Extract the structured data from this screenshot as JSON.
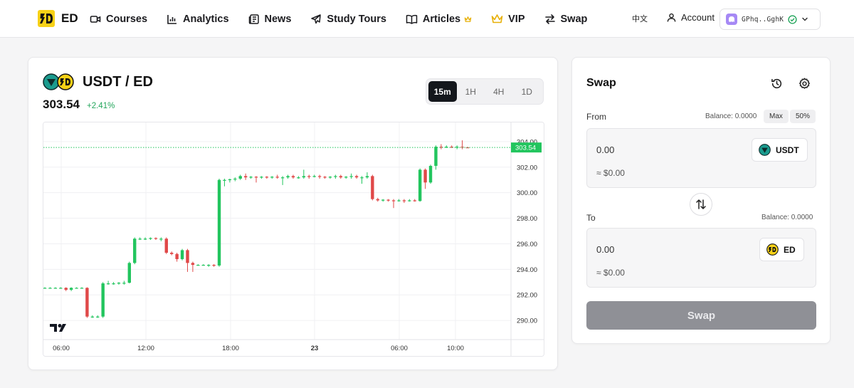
{
  "brand": {
    "name": "ED"
  },
  "nav": [
    {
      "label": "Courses",
      "icon": "video-camera-icon"
    },
    {
      "label": "Analytics",
      "icon": "bar-chart-icon"
    },
    {
      "label": "News",
      "icon": "newspaper-icon"
    },
    {
      "label": "Study Tours",
      "icon": "airplane-icon"
    },
    {
      "label": "Articles",
      "icon": "book-open-icon",
      "badge_icon": "crown-icon"
    },
    {
      "label": "VIP",
      "icon": "crown-icon"
    },
    {
      "label": "Swap",
      "icon": "swap-arrows-icon"
    }
  ],
  "header": {
    "language": "中文",
    "account_label": "Account",
    "wallet_address": "GPhq..GghK"
  },
  "pair": {
    "title": "USDT / ED",
    "price": "303.54",
    "change": "+2.41%",
    "intervals": [
      "15m",
      "1H",
      "4H",
      "1D"
    ],
    "active_interval": "15m"
  },
  "colors": {
    "up": "#22c55e",
    "down": "#e04848",
    "accent_dark": "#14171c",
    "logo_yellow": "#f7d117",
    "usdt_teal": "#1a9b8e"
  },
  "chart_data": {
    "type": "candlestick",
    "x_ticks": [
      "06:00",
      "12:00",
      "18:00",
      "23",
      "06:00",
      "10:00"
    ],
    "y_ticks": [
      "304.00",
      "302.00",
      "300.00",
      "298.00",
      "296.00",
      "294.00",
      "292.00",
      "290.00"
    ],
    "ylim": [
      288.5,
      305.5
    ],
    "last_price_label": "303.54",
    "last_price": 303.54,
    "grid": true,
    "candles": [
      [
        292.55,
        292.55,
        292.6,
        292.5
      ],
      [
        292.55,
        292.55,
        292.6,
        292.5
      ],
      [
        292.55,
        292.55,
        292.6,
        292.5
      ],
      [
        292.55,
        292.55,
        292.6,
        292.5
      ],
      [
        292.55,
        292.4,
        292.6,
        292.3
      ],
      [
        292.4,
        292.55,
        292.6,
        292.3
      ],
      [
        292.55,
        292.55,
        292.6,
        292.5
      ],
      [
        292.55,
        292.55,
        292.6,
        292.5
      ],
      [
        292.55,
        290.3,
        292.6,
        290.2
      ],
      [
        290.3,
        290.3,
        290.4,
        290.2
      ],
      [
        290.3,
        290.3,
        290.4,
        290.2
      ],
      [
        290.3,
        292.9,
        293.0,
        290.2
      ],
      [
        292.9,
        292.9,
        293.1,
        292.8
      ],
      [
        292.9,
        292.9,
        293.0,
        292.8
      ],
      [
        292.9,
        292.95,
        293.0,
        292.8
      ],
      [
        292.95,
        292.95,
        293.1,
        292.8
      ],
      [
        292.95,
        294.5,
        294.6,
        292.9
      ],
      [
        294.5,
        296.4,
        296.5,
        294.4
      ],
      [
        296.4,
        296.4,
        296.5,
        296.3
      ],
      [
        296.4,
        296.4,
        296.5,
        296.3
      ],
      [
        296.4,
        296.45,
        296.5,
        296.3
      ],
      [
        296.45,
        296.4,
        296.5,
        296.3
      ],
      [
        296.4,
        296.4,
        296.5,
        296.2
      ],
      [
        296.4,
        295.3,
        296.5,
        295.2
      ],
      [
        295.3,
        295.2,
        295.4,
        295.1
      ],
      [
        295.2,
        294.8,
        295.3,
        294.6
      ],
      [
        294.8,
        295.5,
        295.6,
        294.7
      ],
      [
        295.5,
        294.5,
        295.6,
        293.8
      ],
      [
        294.5,
        294.35,
        294.6,
        293.8
      ],
      [
        294.35,
        294.35,
        294.4,
        294.3
      ],
      [
        294.35,
        294.35,
        294.4,
        294.3
      ],
      [
        294.35,
        294.35,
        294.4,
        294.2
      ],
      [
        294.35,
        294.3,
        294.4,
        294.2
      ],
      [
        294.3,
        301.0,
        301.1,
        294.2
      ],
      [
        301.0,
        301.0,
        301.1,
        300.5
      ],
      [
        301.0,
        301.05,
        301.1,
        300.8
      ],
      [
        301.05,
        301.1,
        301.2,
        300.9
      ],
      [
        301.1,
        301.3,
        301.4,
        301.0
      ],
      [
        301.3,
        301.2,
        301.5,
        301.0
      ],
      [
        301.2,
        301.25,
        301.3,
        301.1
      ],
      [
        301.25,
        301.2,
        301.3,
        300.8
      ],
      [
        301.2,
        301.25,
        301.3,
        301.1
      ],
      [
        301.25,
        301.2,
        301.3,
        301.1
      ],
      [
        301.2,
        301.25,
        301.3,
        301.1
      ],
      [
        301.25,
        301.2,
        301.4,
        301.1
      ],
      [
        301.2,
        301.2,
        301.3,
        300.6
      ],
      [
        301.2,
        301.3,
        301.4,
        301.1
      ],
      [
        301.3,
        301.2,
        301.4,
        301.1
      ],
      [
        301.2,
        301.2,
        301.3,
        301.1
      ],
      [
        301.2,
        301.3,
        301.8,
        301.1
      ],
      [
        301.3,
        301.25,
        301.4,
        301.1
      ],
      [
        301.25,
        301.3,
        301.4,
        301.2
      ],
      [
        301.3,
        301.25,
        301.4,
        301.1
      ],
      [
        301.25,
        301.2,
        301.3,
        301.1
      ],
      [
        301.2,
        301.25,
        301.3,
        301.1
      ],
      [
        301.25,
        301.3,
        301.4,
        301.1
      ],
      [
        301.3,
        301.2,
        301.4,
        301.1
      ],
      [
        301.2,
        301.25,
        301.3,
        301.1
      ],
      [
        301.25,
        301.3,
        301.5,
        301.1
      ],
      [
        301.3,
        301.2,
        301.4,
        301.1
      ],
      [
        301.2,
        301.2,
        301.3,
        300.7
      ],
      [
        301.2,
        301.3,
        301.6,
        301.1
      ],
      [
        301.3,
        299.5,
        301.4,
        299.4
      ],
      [
        299.5,
        299.4,
        299.6,
        299.3
      ],
      [
        299.4,
        299.45,
        299.5,
        299.3
      ],
      [
        299.45,
        299.4,
        299.5,
        299.3
      ],
      [
        299.4,
        299.35,
        299.5,
        298.8
      ],
      [
        299.35,
        299.4,
        299.5,
        299.3
      ],
      [
        299.4,
        299.35,
        299.5,
        299.2
      ],
      [
        299.35,
        299.4,
        299.5,
        299.3
      ],
      [
        299.4,
        299.35,
        299.5,
        299.3
      ],
      [
        299.35,
        301.8,
        301.9,
        299.3
      ],
      [
        301.8,
        300.8,
        301.9,
        300.3
      ],
      [
        300.8,
        302.1,
        302.2,
        300.7
      ],
      [
        302.1,
        303.6,
        303.7,
        301.8
      ],
      [
        303.6,
        303.55,
        303.8,
        303.4
      ],
      [
        303.55,
        303.6,
        303.7,
        303.5
      ],
      [
        303.6,
        303.55,
        303.7,
        303.5
      ],
      [
        303.55,
        303.6,
        303.7,
        303.4
      ],
      [
        303.6,
        303.55,
        304.1,
        303.4
      ],
      [
        303.55,
        303.54,
        303.6,
        303.5
      ]
    ]
  },
  "swap": {
    "title": "Swap",
    "history_icon": "history-icon",
    "settings_icon": "gear-icon",
    "from_label": "From",
    "from_balance": "Balance: 0.0000",
    "max_label": "Max",
    "half_label": "50%",
    "from_amount": "0.00",
    "from_usd": "≈ $0.00",
    "from_token": "USDT",
    "to_label": "To",
    "to_balance": "Balance: 0.0000",
    "to_amount": "0.00",
    "to_usd": "≈ $0.00",
    "to_token": "ED",
    "button_label": "Swap"
  }
}
